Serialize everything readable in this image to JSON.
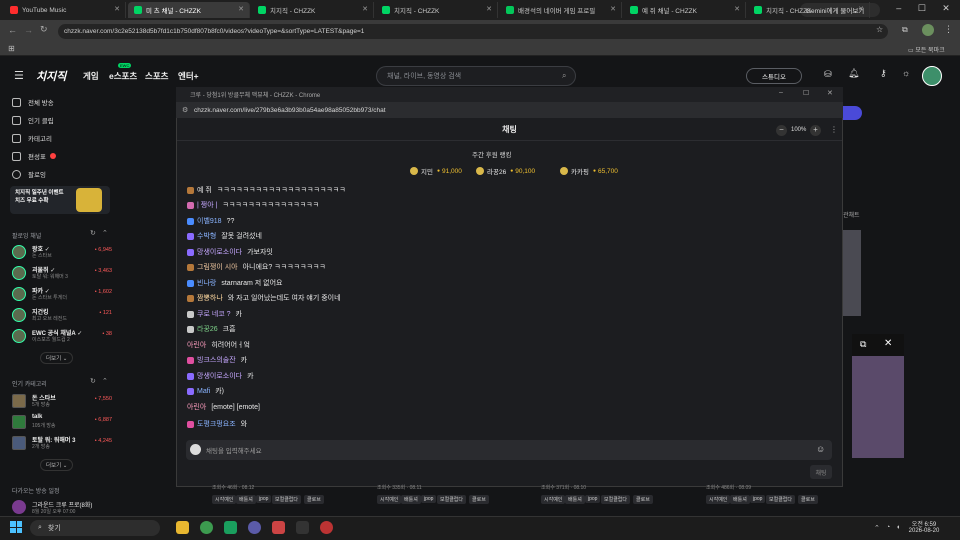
{
  "browser": {
    "tabs": [
      {
        "label": "YouTube Music",
        "color": "#ff2d2d"
      },
      {
        "label": "미 츠 채널 - CHZZK",
        "color": "#00d564"
      },
      {
        "label": "치지직 - CHZZK",
        "color": "#00d564"
      },
      {
        "label": "치지직 - CHZZK",
        "color": "#00d564"
      },
      {
        "label": "배경석의 네이버 게임 프로필",
        "color": "#03c75a"
      },
      {
        "label": "예 쥐 채널 - CHZZK",
        "color": "#00d564"
      },
      {
        "label": "치지직 - CHZZK",
        "color": "#00d564"
      }
    ],
    "gemini_label": "Gemini에게 물어보기",
    "url": "chzzk.naver.com/3c2e52138d5b7fd1c1b750df807b8fc0/videos?videoType=&sortType=LATEST&page=1",
    "bookmarks_label": "모든 북마크"
  },
  "site": {
    "logo": "치지직",
    "nav": [
      "게임",
      "e스포츠",
      "스포츠",
      "엔터+"
    ],
    "search_placeholder": "채널, 라이브, 동영상 검색",
    "studio_label": "스튜디오"
  },
  "sidebar": {
    "menu": [
      "전체 방송",
      "인기 클립",
      "카테고리",
      "편성표",
      "팔로잉"
    ],
    "banner_text": "치지직 일주년 이벤트 치즈 무료 수확",
    "following_title": "팔로잉 채널",
    "following": [
      {
        "name": "왕호 ✓",
        "sub": "돈 스타브",
        "count": "6,945"
      },
      {
        "name": "괴물쥐 ✓",
        "sub": "토탈 워: 워해머 3",
        "count": "3,463"
      },
      {
        "name": "파카 ✓",
        "sub": "돈 스타브 투게더",
        "count": "1,602"
      },
      {
        "name": "지건킹",
        "sub": "최고 오브 레전드",
        "count": "121"
      },
      {
        "name": "EWC 공식 채널A ✓",
        "sub": "이스포츠 월드컵 2",
        "count": "38"
      }
    ],
    "more_label": "더보기",
    "category_title": "인기 카테고리",
    "categories": [
      {
        "name": "돈 스타브",
        "sub": "5개 방송",
        "count": "7,550"
      },
      {
        "name": "talk",
        "sub": "105개 방송",
        "count": "6,887"
      },
      {
        "name": "토탈 워: 워해머 3",
        "sub": "2개 방송",
        "count": "4,245"
      }
    ],
    "more_label2": "더보기",
    "schedule_title": "다가오는 방송 일정",
    "schedule_item": "그라운드 크루 프로(8화)",
    "schedule_time": "8월 20일 오후 07:00"
  },
  "popup": {
    "title": "크루 - 당첨1위 방클무체 맥뷰체 - CHZZK - Chrome",
    "url": "chzzk.naver.com/live/279b3e6a3b93b0a54ae98a85052bb973/chat",
    "chat_title": "채팅",
    "zoom": "100%",
    "ranking_title": "주간 후원 랭킹",
    "ranking": [
      {
        "name": "지민",
        "amount": "91,000"
      },
      {
        "name": "라꿍26",
        "amount": "90,100"
      },
      {
        "name": "카카핑",
        "amount": "65,700"
      }
    ],
    "messages": [
      {
        "name": "예 쥐",
        "text": "ㅋㅋㅋㅋㅋㅋㅋㅋㅋㅋㅋㅋㅋㅋㅋㅋㅋㅋㅋㅋ",
        "ncolor": "#e8e8e8",
        "badge": "#b5783a"
      },
      {
        "name": "| 쩡아 |",
        "text": "ㅋㅋㅋㅋㅋㅋㅋㅋㅋㅋㅋㅋㅋㅋㅋ",
        "ncolor": "#c6a8ff",
        "badge": "#d46bb0"
      },
      {
        "name": "이벨918",
        "text": "??",
        "ncolor": "#8ab4ff",
        "badge": "#4a8cff"
      },
      {
        "name": "수박형",
        "text": "잘못 걸려섰네",
        "ncolor": "#8ab4ff",
        "badge": "#8a6bff"
      },
      {
        "name": "망생이로소이다",
        "text": "가보자잇",
        "ncolor": "#c6a8ff",
        "badge": "#8a6bff"
      },
      {
        "name": "그림쟁이 시아",
        "text": "아니에요? ㅋㅋㅋㅋㅋㅋㅋㅋ",
        "ncolor": "#f0c8a0",
        "badge": "#b5783a"
      },
      {
        "name": "빈나랑",
        "text": "starnaram  저 없어요",
        "ncolor": "#8ab4ff",
        "badge": "#4a8cff"
      },
      {
        "name": "짬뽕하나",
        "text": "와 자고 일어났는데도 여자 얘기 중이네",
        "ncolor": "#ffd9a0",
        "badge": "#b5783a"
      },
      {
        "name": "쿠로 네코 ?",
        "text": "카",
        "ncolor": "#c6a8ff",
        "badge": "#c9c9c9"
      },
      {
        "name": "라꿍26",
        "text": "크흠",
        "ncolor": "#7fd38a",
        "badge": "#c9c9c9"
      },
      {
        "name": "아린아",
        "text": "히려어어ㅓ엌",
        "ncolor": "#ff9ec0",
        "badge": ""
      },
      {
        "name": "빙크스의술잔",
        "text": "카",
        "ncolor": "#c6a8ff",
        "badge": "#e04fa0"
      },
      {
        "name": "망생이로소이다",
        "text": "카",
        "ncolor": "#c6a8ff",
        "badge": "#8a6bff"
      },
      {
        "name": "Mafi",
        "text": "카)",
        "ncolor": "#8ab4ff",
        "badge": "#8a6bff"
      },
      {
        "name": "아린아",
        "text": "[emote] [emote]",
        "ncolor": "#ff9ec0",
        "badge": ""
      },
      {
        "name": "도평크펑요조",
        "text": "와",
        "ncolor": "#8ab4ff",
        "badge": "#e04fa0"
      }
    ],
    "input_placeholder": "채팅을 입력해주세요",
    "send_label": "채팅"
  },
  "main": {
    "chips": [
      "시각예인",
      "배틀셔",
      "jpop",
      "보컬클럽다",
      "클로브"
    ],
    "meta": [
      "조회수 46회 · 08.12",
      "조회수 335회 · 08.11",
      "조회수 371회 · 08.10",
      "조회수 486회 · 08.09"
    ],
    "partial_text": "관채트"
  },
  "taskbar": {
    "search_label": "찾기",
    "time": "오전 6:59",
    "date": "2026-08-20"
  }
}
